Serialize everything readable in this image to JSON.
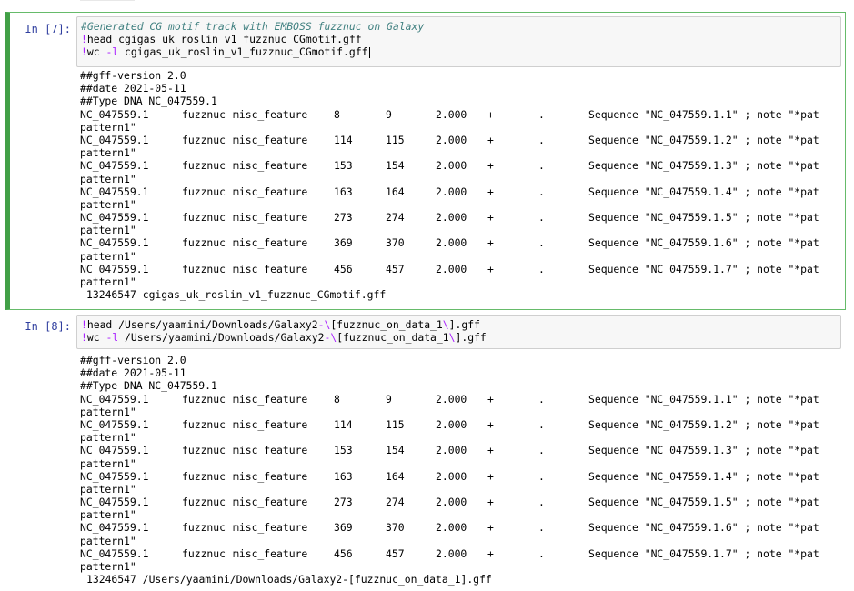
{
  "cells": [
    {
      "prompt": "In [7]:",
      "code": {
        "comment": "#Generated CG motif track with EMBOSS fuzznuc on Galaxy",
        "line2_bang": "!",
        "line2_rest": "head cgigas_uk_roslin_v1_fuzznuc_CGmotif.gff",
        "line3_bang": "!",
        "line3_cmd": "wc ",
        "line3_flag": "-l",
        "line3_rest": " cgigas_uk_roslin_v1_fuzznuc_CGmotif.gff"
      },
      "output": {
        "headers": [
          "##gff-version 2.0",
          "##date 2021-05-11",
          "##Type DNA NC_047559.1"
        ],
        "rows": [
          {
            "seq": "NC_047559.1",
            "source": "fuzznuc",
            "type": "misc_feature",
            "start": "8",
            "end": "9",
            "score": "2.000",
            "strand": "+",
            "phase": ".",
            "attr": "Sequence \"NC_047559.1.1\" ; note \"*pat",
            "wrap": "pattern1\""
          },
          {
            "seq": "NC_047559.1",
            "source": "fuzznuc",
            "type": "misc_feature",
            "start": "114",
            "end": "115",
            "score": "2.000",
            "strand": "+",
            "phase": ".",
            "attr": "Sequence \"NC_047559.1.2\" ; note \"*pat",
            "wrap": "pattern1\""
          },
          {
            "seq": "NC_047559.1",
            "source": "fuzznuc",
            "type": "misc_feature",
            "start": "153",
            "end": "154",
            "score": "2.000",
            "strand": "+",
            "phase": ".",
            "attr": "Sequence \"NC_047559.1.3\" ; note \"*pat",
            "wrap": "pattern1\""
          },
          {
            "seq": "NC_047559.1",
            "source": "fuzznuc",
            "type": "misc_feature",
            "start": "163",
            "end": "164",
            "score": "2.000",
            "strand": "+",
            "phase": ".",
            "attr": "Sequence \"NC_047559.1.4\" ; note \"*pat",
            "wrap": "pattern1\""
          },
          {
            "seq": "NC_047559.1",
            "source": "fuzznuc",
            "type": "misc_feature",
            "start": "273",
            "end": "274",
            "score": "2.000",
            "strand": "+",
            "phase": ".",
            "attr": "Sequence \"NC_047559.1.5\" ; note \"*pat",
            "wrap": "pattern1\""
          },
          {
            "seq": "NC_047559.1",
            "source": "fuzznuc",
            "type": "misc_feature",
            "start": "369",
            "end": "370",
            "score": "2.000",
            "strand": "+",
            "phase": ".",
            "attr": "Sequence \"NC_047559.1.6\" ; note \"*pat",
            "wrap": "pattern1\""
          },
          {
            "seq": "NC_047559.1",
            "source": "fuzznuc",
            "type": "misc_feature",
            "start": "456",
            "end": "457",
            "score": "2.000",
            "strand": "+",
            "phase": ".",
            "attr": "Sequence \"NC_047559.1.7\" ; note \"*pat",
            "wrap": "pattern1\""
          }
        ],
        "wc": "13246547 cgigas_uk_roslin_v1_fuzznuc_CGmotif.gff"
      }
    },
    {
      "prompt": "In [8]:",
      "code": {
        "line1_bang": "!",
        "line1_a": "head /Users/yaamini/Downloads/Galaxy2",
        "line1_b": "-\\",
        "line1_c": "[fuzznuc_on_data_1",
        "line1_d": "\\",
        "line1_e": "].gff",
        "line2_bang": "!",
        "line2_cmd": "wc ",
        "line2_flag": "-l",
        "line2_a": " /Users/yaamini/Downloads/Galaxy2",
        "line2_b": "-\\",
        "line2_c": "[fuzznuc_on_data_1",
        "line2_d": "\\",
        "line2_e": "].gff"
      },
      "output": {
        "headers": [
          "##gff-version 2.0",
          "##date 2021-05-11",
          "##Type DNA NC_047559.1"
        ],
        "rows": [
          {
            "seq": "NC_047559.1",
            "source": "fuzznuc",
            "type": "misc_feature",
            "start": "8",
            "end": "9",
            "score": "2.000",
            "strand": "+",
            "phase": ".",
            "attr": "Sequence \"NC_047559.1.1\" ; note \"*pat",
            "wrap": "pattern1\""
          },
          {
            "seq": "NC_047559.1",
            "source": "fuzznuc",
            "type": "misc_feature",
            "start": "114",
            "end": "115",
            "score": "2.000",
            "strand": "+",
            "phase": ".",
            "attr": "Sequence \"NC_047559.1.2\" ; note \"*pat",
            "wrap": "pattern1\""
          },
          {
            "seq": "NC_047559.1",
            "source": "fuzznuc",
            "type": "misc_feature",
            "start": "153",
            "end": "154",
            "score": "2.000",
            "strand": "+",
            "phase": ".",
            "attr": "Sequence \"NC_047559.1.3\" ; note \"*pat",
            "wrap": "pattern1\""
          },
          {
            "seq": "NC_047559.1",
            "source": "fuzznuc",
            "type": "misc_feature",
            "start": "163",
            "end": "164",
            "score": "2.000",
            "strand": "+",
            "phase": ".",
            "attr": "Sequence \"NC_047559.1.4\" ; note \"*pat",
            "wrap": "pattern1\""
          },
          {
            "seq": "NC_047559.1",
            "source": "fuzznuc",
            "type": "misc_feature",
            "start": "273",
            "end": "274",
            "score": "2.000",
            "strand": "+",
            "phase": ".",
            "attr": "Sequence \"NC_047559.1.5\" ; note \"*pat",
            "wrap": "pattern1\""
          },
          {
            "seq": "NC_047559.1",
            "source": "fuzznuc",
            "type": "misc_feature",
            "start": "369",
            "end": "370",
            "score": "2.000",
            "strand": "+",
            "phase": ".",
            "attr": "Sequence \"NC_047559.1.6\" ; note \"*pat",
            "wrap": "pattern1\""
          },
          {
            "seq": "NC_047559.1",
            "source": "fuzznuc",
            "type": "misc_feature",
            "start": "456",
            "end": "457",
            "score": "2.000",
            "strand": "+",
            "phase": ".",
            "attr": "Sequence \"NC_047559.1.7\" ; note \"*pat",
            "wrap": "pattern1\""
          }
        ],
        "wc": "13246547 /Users/yaamini/Downloads/Galaxy2-[fuzznuc_on_data_1].gff"
      }
    }
  ],
  "colors": {
    "selected_cell_border": "#42a047",
    "prompt": "#303f9f",
    "comment": "#408080",
    "bang": "#aa22ff",
    "escape": "#bb6622",
    "input_bg": "#f7f7f7"
  }
}
